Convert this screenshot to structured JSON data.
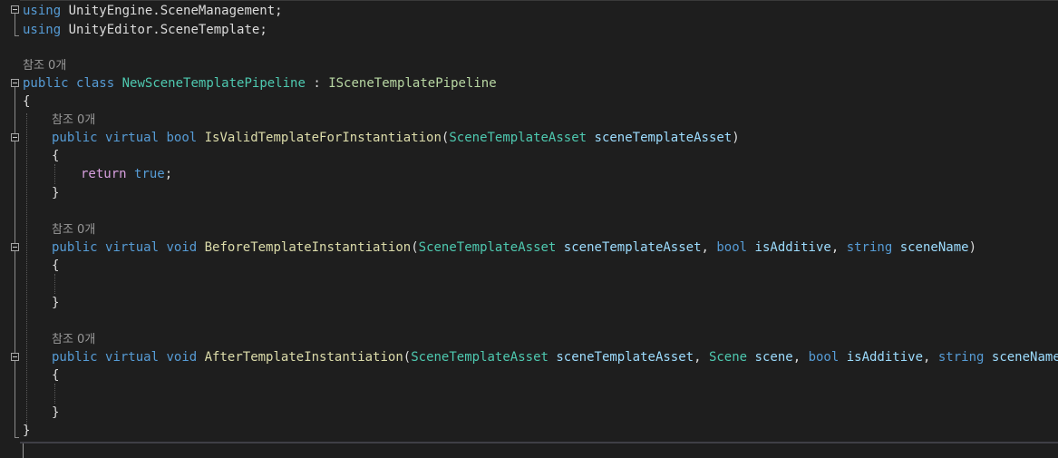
{
  "hints": {
    "ref_count": "참조 0개"
  },
  "syntax": {
    "using": "using",
    "public": "public",
    "class": "class",
    "virtual": "virtual",
    "bool": "bool",
    "void": "void",
    "string": "string",
    "return": "return",
    "true": "true"
  },
  "code": {
    "namespace_scene_management": "UnityEngine.SceneManagement",
    "namespace_scene_template": "UnityEditor.SceneTemplate",
    "class_name": "NewSceneTemplatePipeline",
    "interface_name": "ISceneTemplatePipeline",
    "type_scene_template_asset": "SceneTemplateAsset",
    "type_scene": "Scene",
    "method_is_valid": "IsValidTemplateForInstantiation",
    "method_before": "BeforeTemplateInstantiation",
    "method_after": "AfterTemplateInstantiation",
    "param_scene_template_asset": "sceneTemplateAsset",
    "param_is_additive": "isAdditive",
    "param_scene_name": "sceneName",
    "param_scene": "scene"
  },
  "colors": {
    "background": "#1e1e1e",
    "keyword": "#569cd6",
    "type": "#4ec9b0",
    "interface": "#b8d7a3",
    "method": "#dcdcaa",
    "parameter": "#9cdcfe",
    "control": "#d8a0df",
    "plain": "#dcdcdc",
    "hint": "#999999"
  },
  "icons": [
    "collapse-icon"
  ]
}
